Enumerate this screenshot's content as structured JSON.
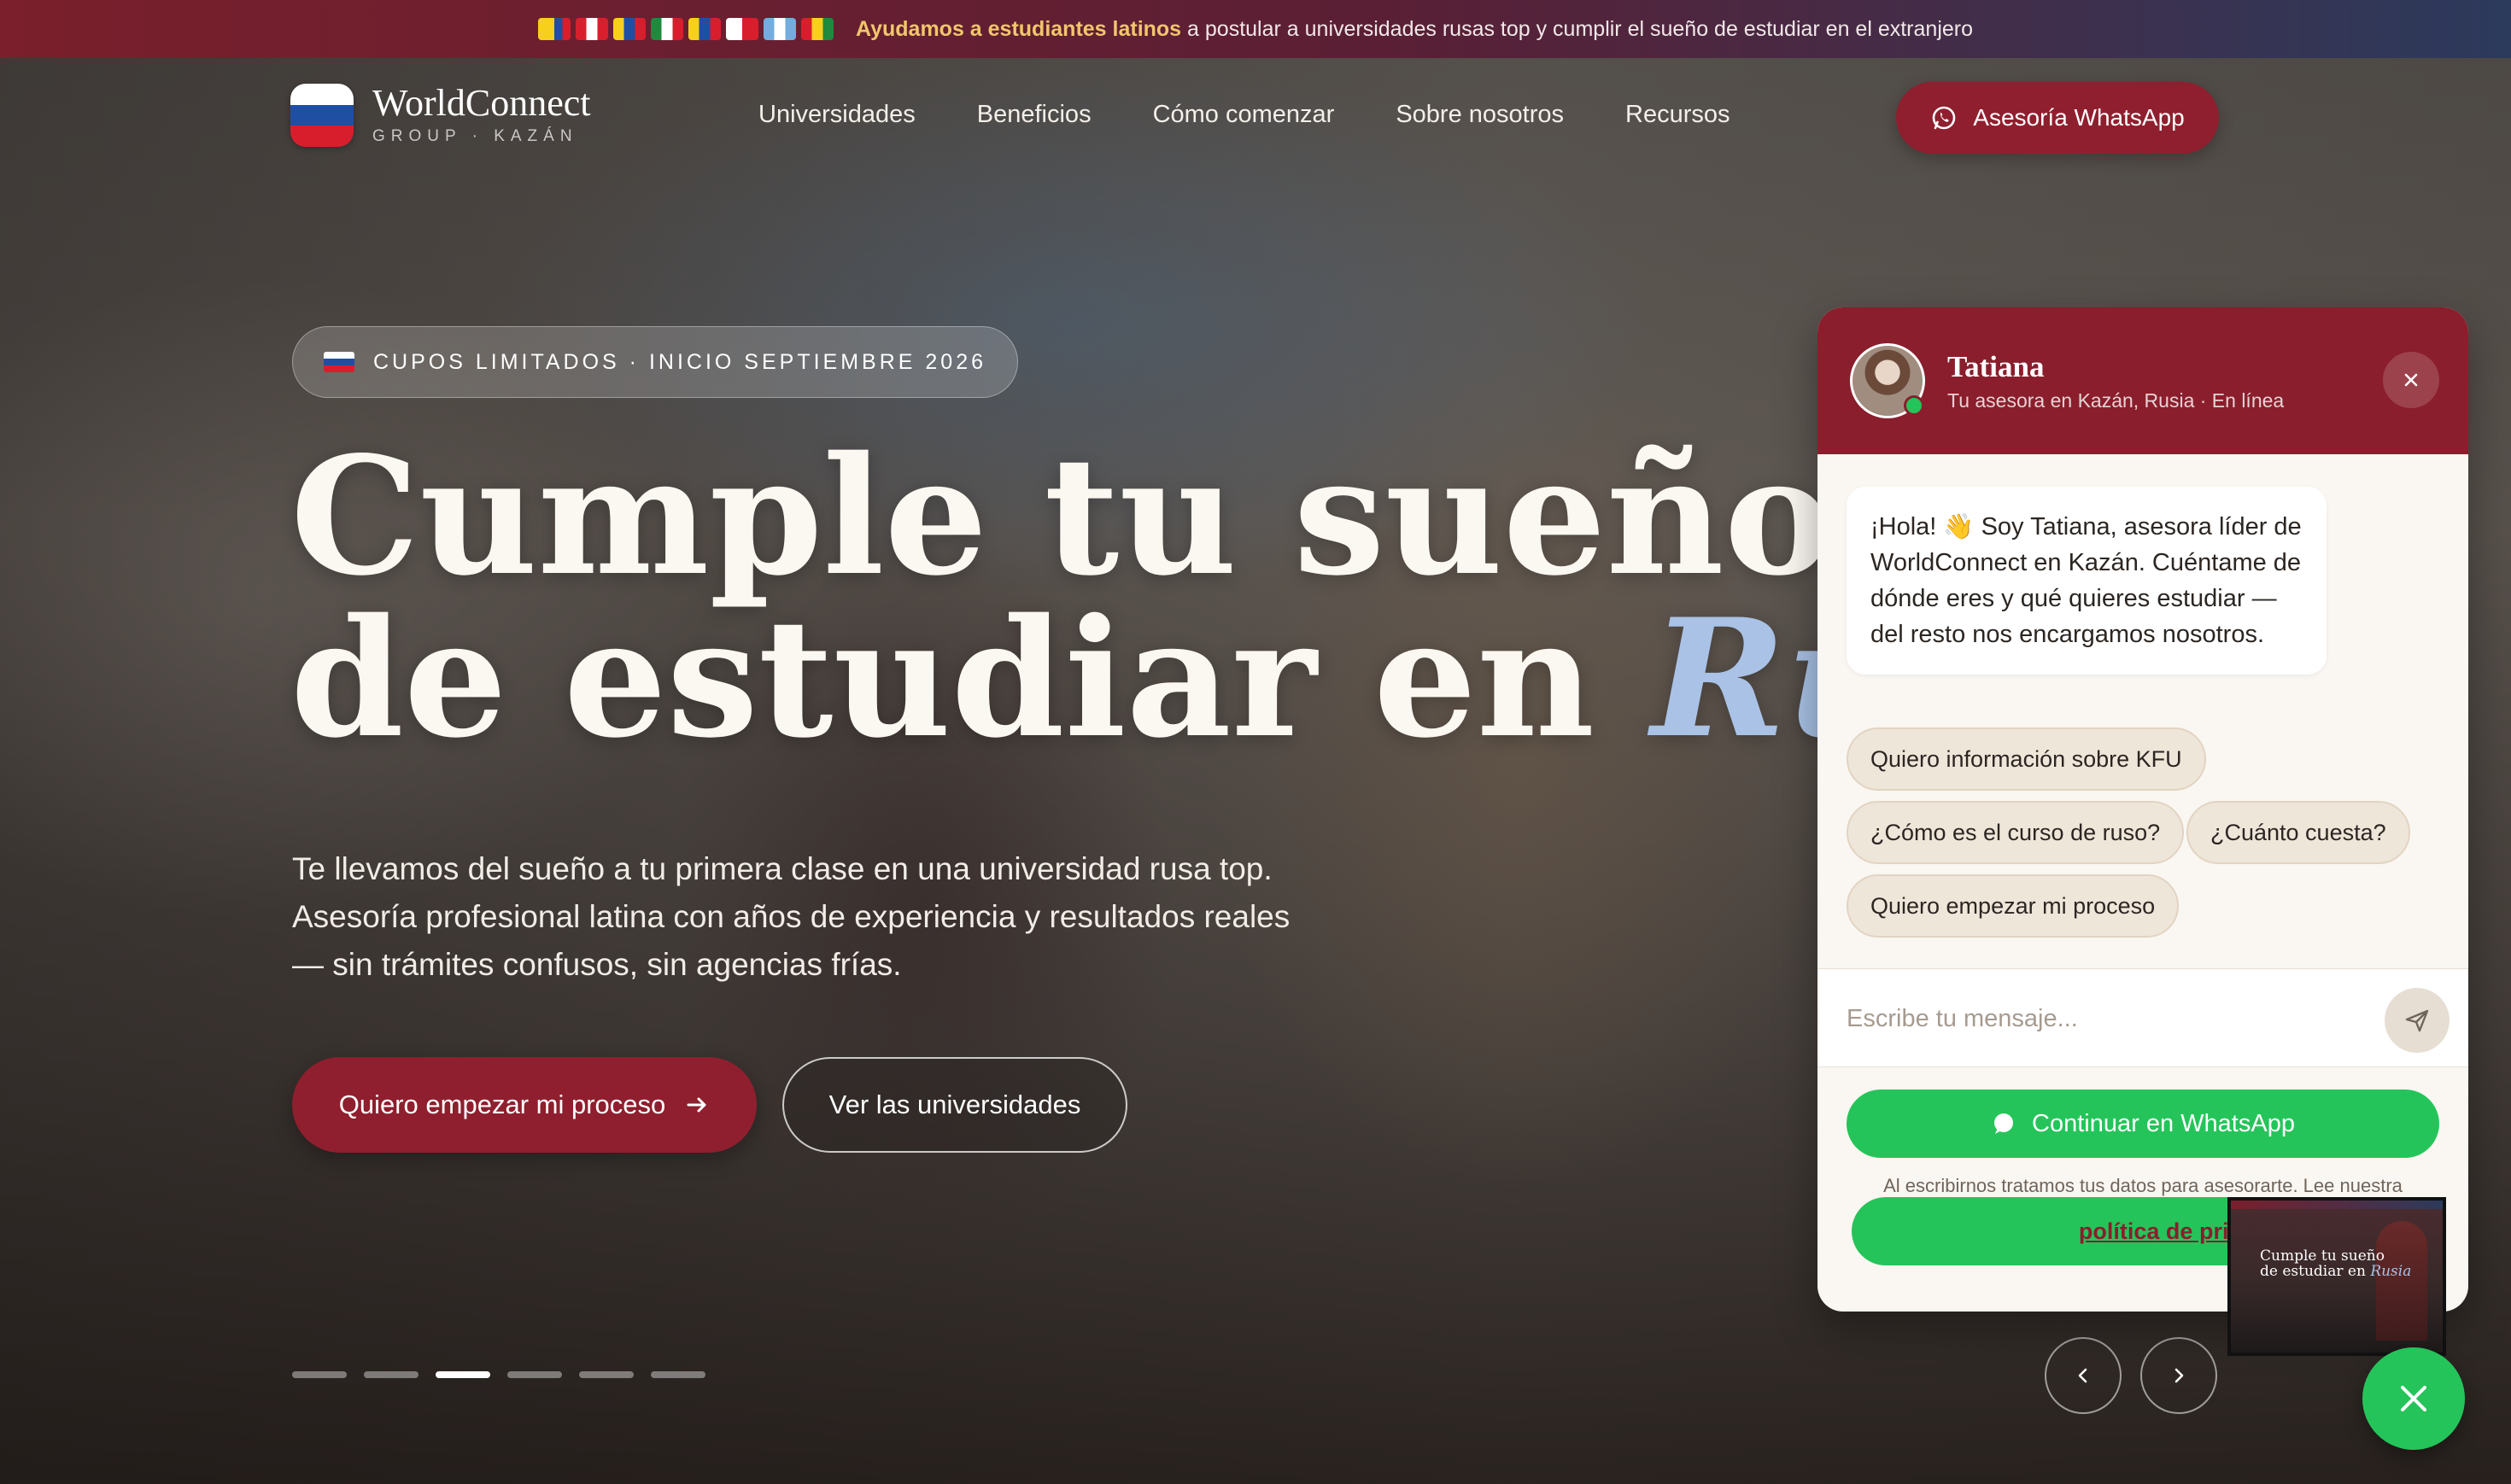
{
  "topbar": {
    "highlight": "Ayudamos a estudiantes latinos",
    "message": "a postular a universidades rusas top y cumplir el sueño de estudiar en el extranjero",
    "flags": [
      {
        "name": "colombia",
        "colors": [
          "#f7cf1d",
          "#f7cf1d",
          "#1f4fa3",
          "#d81e2c"
        ]
      },
      {
        "name": "peru",
        "colors": [
          "#d91f2d",
          "#ffffff",
          "#d91f2d"
        ]
      },
      {
        "name": "venezuela-like",
        "colors": [
          "#f7cf1d",
          "#1f4fa3",
          "#d81e2c"
        ]
      },
      {
        "name": "mexico",
        "colors": [
          "#1f8a3e",
          "#ffffff",
          "#d81e2c"
        ]
      },
      {
        "name": "ecuador",
        "colors": [
          "#f7cf1d",
          "#1f4fa3",
          "#d81e2c"
        ]
      },
      {
        "name": "chile",
        "colors": [
          "#ffffff",
          "#d81e2c"
        ]
      },
      {
        "name": "argentina",
        "colors": [
          "#74acdf",
          "#ffffff",
          "#74acdf"
        ]
      },
      {
        "name": "bolivia",
        "colors": [
          "#d81e2c",
          "#f7cf1d",
          "#1f8a3e"
        ]
      }
    ]
  },
  "logo": {
    "name": "WorldConnect",
    "sub": "GROUP · KAZÁN"
  },
  "nav": {
    "items": [
      "Universidades",
      "Beneficios",
      "Cómo comenzar",
      "Sobre nosotros",
      "Recursos"
    ]
  },
  "header_cta": {
    "label": "Asesoría WhatsApp",
    "icon": "whatsapp-icon"
  },
  "hero": {
    "badge": "CUPOS LIMITADOS · INICIO SEPTIEMBRE 2026",
    "title_line1": "Cumple tu sueño",
    "title_line2": "de estudiar en",
    "title_accent": "Rusia",
    "lead": "Te llevamos del sueño a tu primera clase en una universidad rusa top. Asesoría profesional latina con años de experiencia y resultados reales — sin trámites confusos, sin agencias frías.",
    "cta_primary": "Quiero empezar mi proceso",
    "cta_secondary": "Ver las universidades",
    "slides_total": 6,
    "slide_active": 3
  },
  "chat": {
    "agent_name": "Tatiana",
    "agent_sub": "Tu asesora en Kazán, Rusia · En línea",
    "greeting": "¡Hola! 👋 Soy Tatiana, asesora líder de WorldConnect en Kazán. Cuéntame de dónde eres y qué quieres estudiar — del resto nos encargamos nosotros.",
    "quick_replies": [
      "Quiero información sobre KFU",
      "¿Cómo es el curso de ruso?",
      "¿Cuánto cuesta?",
      "Quiero empezar mi proceso"
    ],
    "input_placeholder": "Escribe tu mensaje...",
    "whatsapp_label": "Continuar en WhatsApp",
    "privacy_text": "Al escribirnos tratamos tus datos para asesorarte. Lee nuestra",
    "privacy_link": "política de privacidad"
  },
  "thumbnail": {
    "title_line1": "Cumple tu sueño",
    "title_line2": "de estudiar en",
    "title_accent": "Rusia"
  },
  "colors": {
    "brand": "#8f1f2e",
    "accent_blue": "#a9c2e6",
    "whatsapp_green": "#25c45a"
  }
}
